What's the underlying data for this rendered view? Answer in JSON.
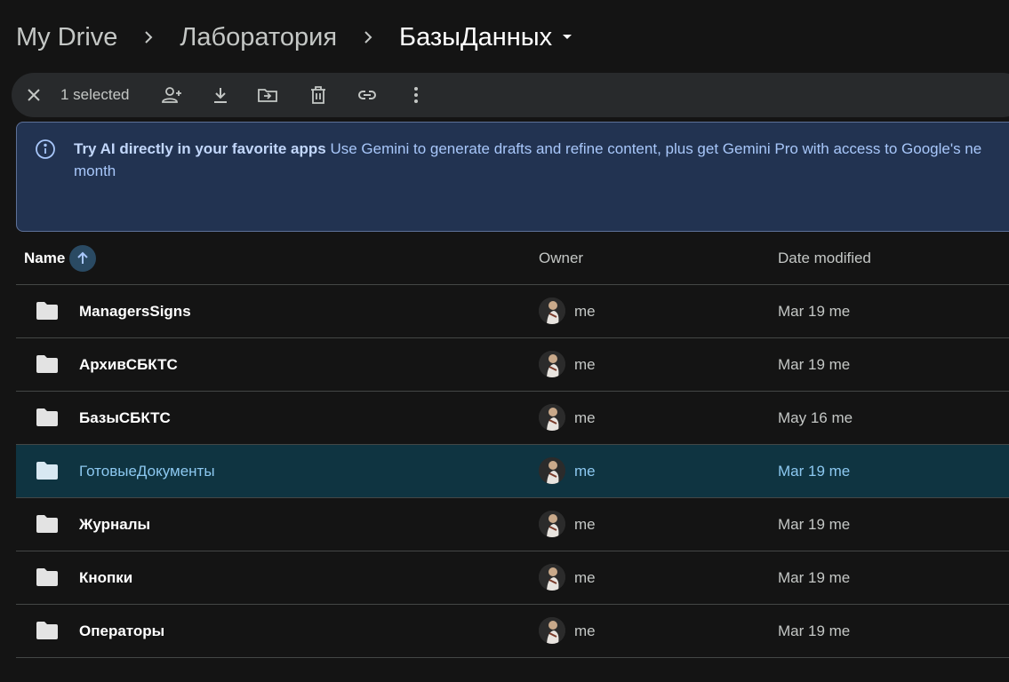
{
  "breadcrumb": {
    "items": [
      "My Drive",
      "Лаборатория",
      "БазыДанных"
    ]
  },
  "toolbar": {
    "selected_label": "1 selected",
    "actions": [
      "close-icon",
      "share-icon",
      "download-icon",
      "move-icon",
      "trash-icon",
      "link-icon",
      "more-icon"
    ]
  },
  "banner": {
    "title": "Try AI directly in your favorite apps",
    "body_line1": "Use Gemini to generate drafts and refine content, plus get Gemini Pro with access to Google's ne",
    "body_line2": "month"
  },
  "table": {
    "headers": {
      "name": "Name",
      "owner": "Owner",
      "date": "Date modified"
    },
    "rows": [
      {
        "name": "ManagersSigns",
        "owner": "me",
        "date": "Mar 19 me",
        "selected": false
      },
      {
        "name": "АрхивСБКТС",
        "owner": "me",
        "date": "Mar 19 me",
        "selected": false
      },
      {
        "name": "БазыСБКТС",
        "owner": "me",
        "date": "May 16 me",
        "selected": false
      },
      {
        "name": "ГотовыеДокументы",
        "owner": "me",
        "date": "Mar 19 me",
        "selected": true
      },
      {
        "name": "Журналы",
        "owner": "me",
        "date": "Mar 19 me",
        "selected": false
      },
      {
        "name": "Кнопки",
        "owner": "me",
        "date": "Mar 19 me",
        "selected": false
      },
      {
        "name": "Операторы",
        "owner": "me",
        "date": "Mar 19 me",
        "selected": false
      }
    ]
  },
  "colors": {
    "background": "#141414",
    "toolbar": "#282a2c",
    "banner": "#223351",
    "selected_row": "#0f3441",
    "accent": "#8cc8f0"
  }
}
